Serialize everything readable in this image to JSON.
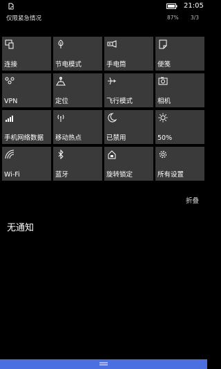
{
  "status": {
    "time": "21:05",
    "emergency": "仅限紧急情况",
    "battery_pct": "87%",
    "page": "3/3"
  },
  "tiles": [
    {
      "label": "连接",
      "icon": "connect-icon"
    },
    {
      "label": "节电模式",
      "icon": "battery-saver-icon"
    },
    {
      "label": "手电筒",
      "icon": "flashlight-icon"
    },
    {
      "label": "便笺",
      "icon": "note-icon"
    },
    {
      "label": "VPN",
      "icon": "vpn-icon"
    },
    {
      "label": "定位",
      "icon": "location-icon"
    },
    {
      "label": "飞行模式",
      "icon": "airplane-icon"
    },
    {
      "label": "相机",
      "icon": "camera-icon"
    },
    {
      "label": "手机网络数据",
      "icon": "signal-icon"
    },
    {
      "label": "移动热点",
      "icon": "hotspot-icon"
    },
    {
      "label": "已禁用",
      "icon": "moon-icon"
    },
    {
      "label": "50%",
      "icon": "brightness-icon"
    },
    {
      "label": "Wi-Fi",
      "icon": "wifi-icon"
    },
    {
      "label": "蓝牙",
      "icon": "bluetooth-icon"
    },
    {
      "label": "旋转锁定",
      "icon": "rotation-lock-icon"
    },
    {
      "label": "所有设置",
      "icon": "gear-icon"
    }
  ],
  "collapse_label": "折叠",
  "no_notifications": "无通知",
  "colors": {
    "tile": "#3a3a3a",
    "accent": "#4b6fe0"
  }
}
